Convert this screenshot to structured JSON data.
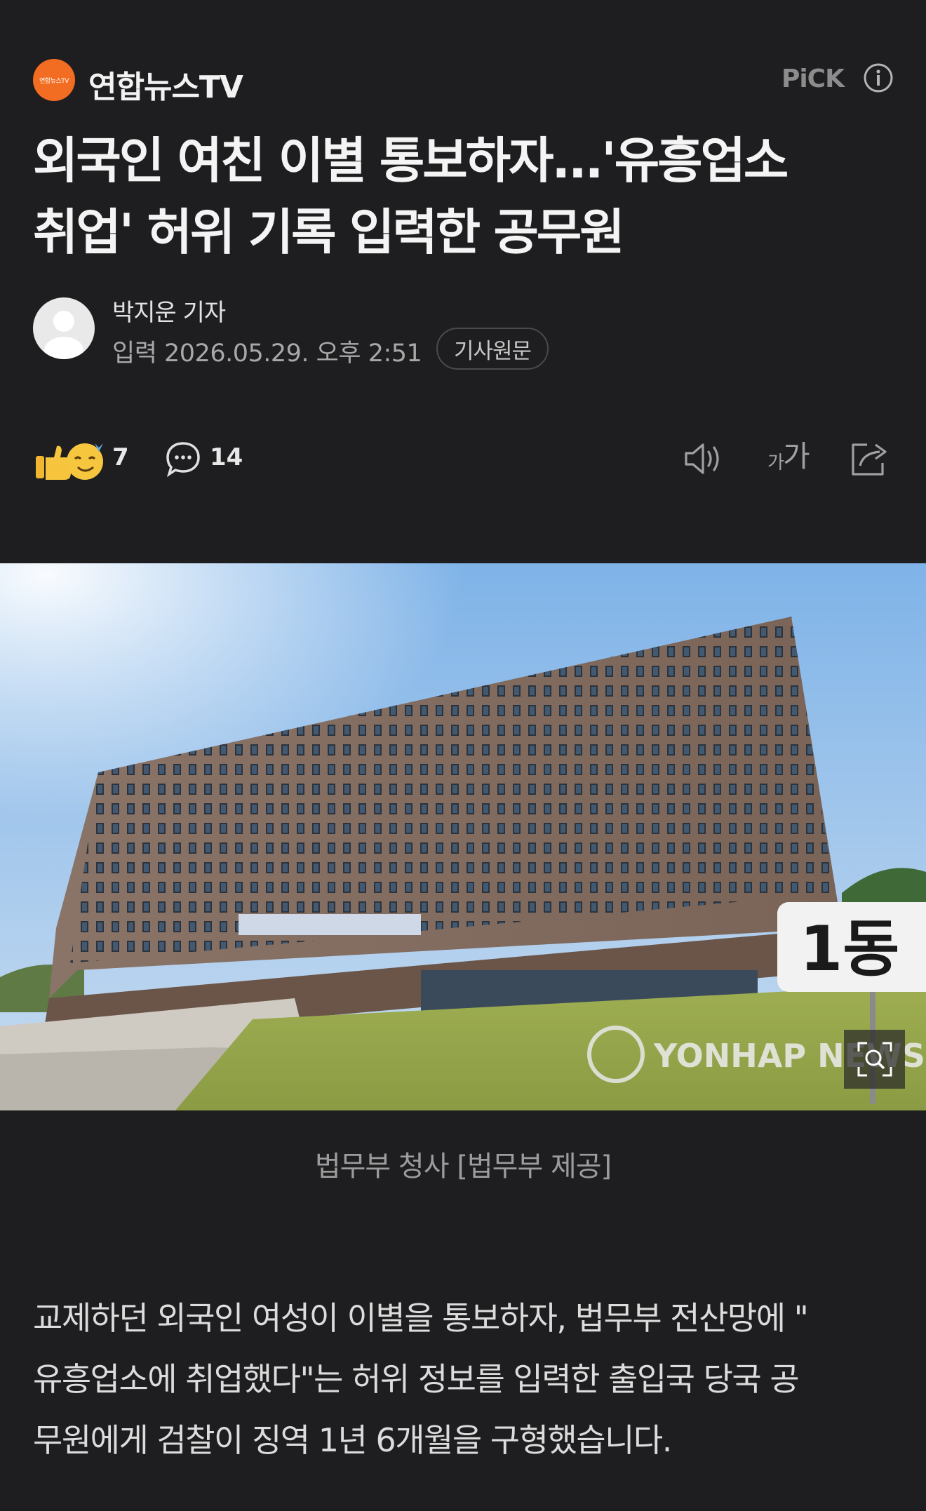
{
  "header": {
    "logo_text": "연합뉴스TV",
    "press_name": "연합뉴스TV",
    "pick_label": "PiCK"
  },
  "article": {
    "title_lines": [
      "외국인 여친 이별 통보하자...'유흥업소",
      "취업' 허위 기록 입력한 공무원"
    ],
    "reporter": "박지운 기자",
    "date": "입력 2026.05.29. 오후 2:51",
    "original_button": "기사원문"
  },
  "reactions": {
    "emoji_count": "7",
    "comment_count": "14",
    "font_size_label_small": "가",
    "font_size_label_big": "가"
  },
  "photo": {
    "sign_text": "1동",
    "watermark": "YONHAP NEWS",
    "caption": "법무부 청사 [법무부 제공]"
  },
  "body": {
    "lines": [
      "교제하던 외국인 여성이 이별을 통보하자, 법무부 전산망에 \"",
      "유흥업소에 취업했다\"는 허위 정보를 입력한 출입국 당국 공",
      "무원에게 검찰이 징역 1년 6개월을 구형했습니다."
    ]
  },
  "colors": {
    "background": "#1e1e20",
    "logo": "#f26d21",
    "text": "#f4f4f4",
    "muted": "#a8a8a8"
  },
  "icons": {
    "info": "info-icon",
    "comment": "comment-icon",
    "speaker": "speaker-icon",
    "share": "share-icon",
    "zoom": "zoom-icon"
  }
}
